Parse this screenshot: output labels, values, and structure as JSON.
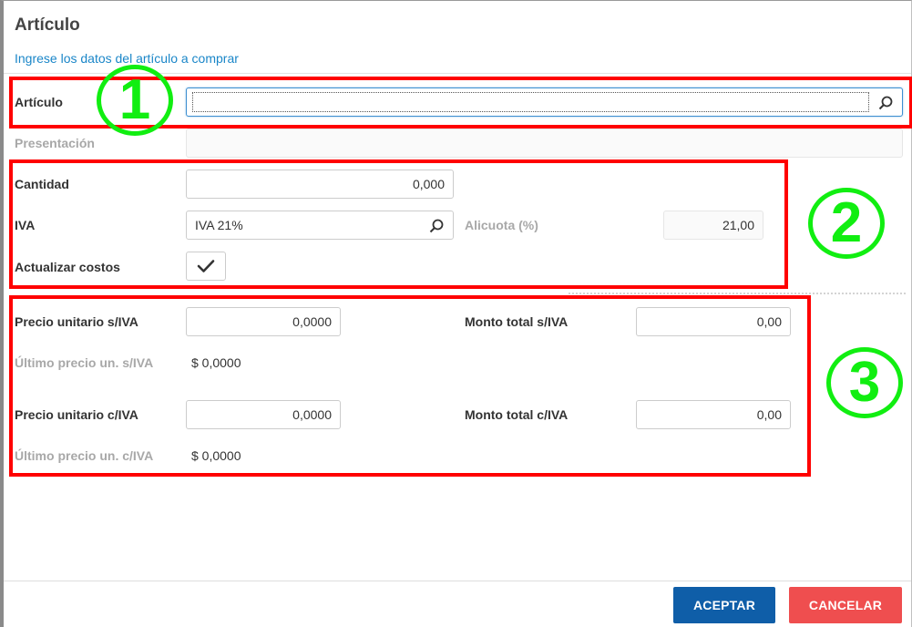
{
  "dialog": {
    "title": "Artículo",
    "subtitle": "Ingrese los datos del artículo a comprar"
  },
  "articulo": {
    "label": "Artículo",
    "value": ""
  },
  "presentacion": {
    "label": "Presentación",
    "value": ""
  },
  "cantidad": {
    "label": "Cantidad",
    "value": "0,000"
  },
  "iva": {
    "label": "IVA",
    "value": "IVA 21%",
    "alicuota_label": "Alicuota (%)",
    "alicuota_value": "21,00"
  },
  "actualizar_costos": {
    "label": "Actualizar costos",
    "checked": true
  },
  "precios": {
    "unit_siva_label": "Precio unitario s/IVA",
    "unit_siva_value": "0,0000",
    "total_siva_label": "Monto total s/IVA",
    "total_siva_value": "0,00",
    "last_siva_label": "Último precio un. s/IVA",
    "last_siva_value": "$ 0,0000",
    "unit_civa_label": "Precio unitario c/IVA",
    "unit_civa_value": "0,0000",
    "total_civa_label": "Monto total c/IVA",
    "total_civa_value": "0,00",
    "last_civa_label": "Último precio un. c/IVA",
    "last_civa_value": "$ 0,0000"
  },
  "buttons": {
    "accept": "ACEPTAR",
    "cancel": "CANCELAR"
  },
  "annotations": {
    "one": "1",
    "two": "2",
    "three": "3"
  },
  "colors": {
    "accent_link": "#1a86c8",
    "accept": "#0f5ea8",
    "cancel": "#ef4e4f",
    "annotation_box": "#ff0000",
    "annotation_circle": "#11ee11"
  },
  "icons": {
    "search": "search-icon",
    "check": "check-icon"
  }
}
